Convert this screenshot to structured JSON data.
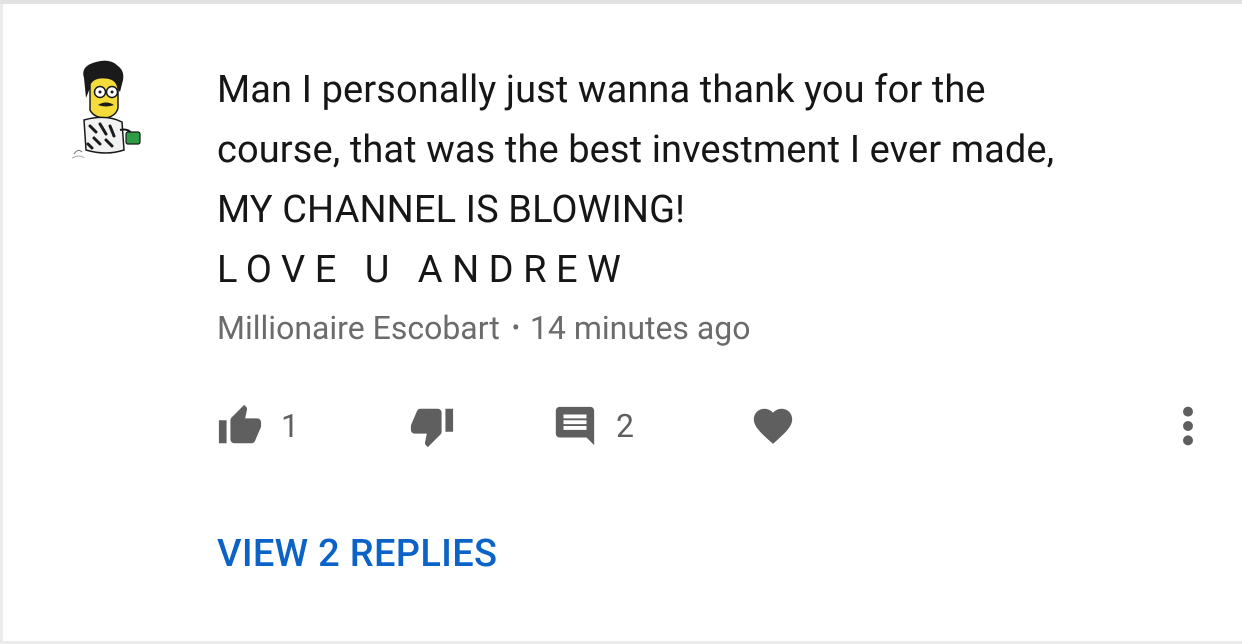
{
  "comment": {
    "lines": [
      "Man I personally just wanna thank you for the",
      "course, that was the best investment I ever made,",
      "MY CHANNEL IS BLOWING!",
      "LOVE U ANDREW"
    ],
    "author": "Millionaire Escobart",
    "separator": "•",
    "time": "14 minutes ago",
    "like_count": "1",
    "reply_count": "2",
    "view_replies_label": "VIEW 2 REPLIES"
  },
  "icons": {
    "like": "thumb-up-icon",
    "dislike": "thumb-down-icon",
    "reply": "comment-icon",
    "heart": "heart-icon",
    "more": "more-vertical-icon"
  },
  "colors": {
    "text": "#161616",
    "meta": "#6b6b6b",
    "icon": "#5f5f5f",
    "link": "#0b63c8"
  }
}
